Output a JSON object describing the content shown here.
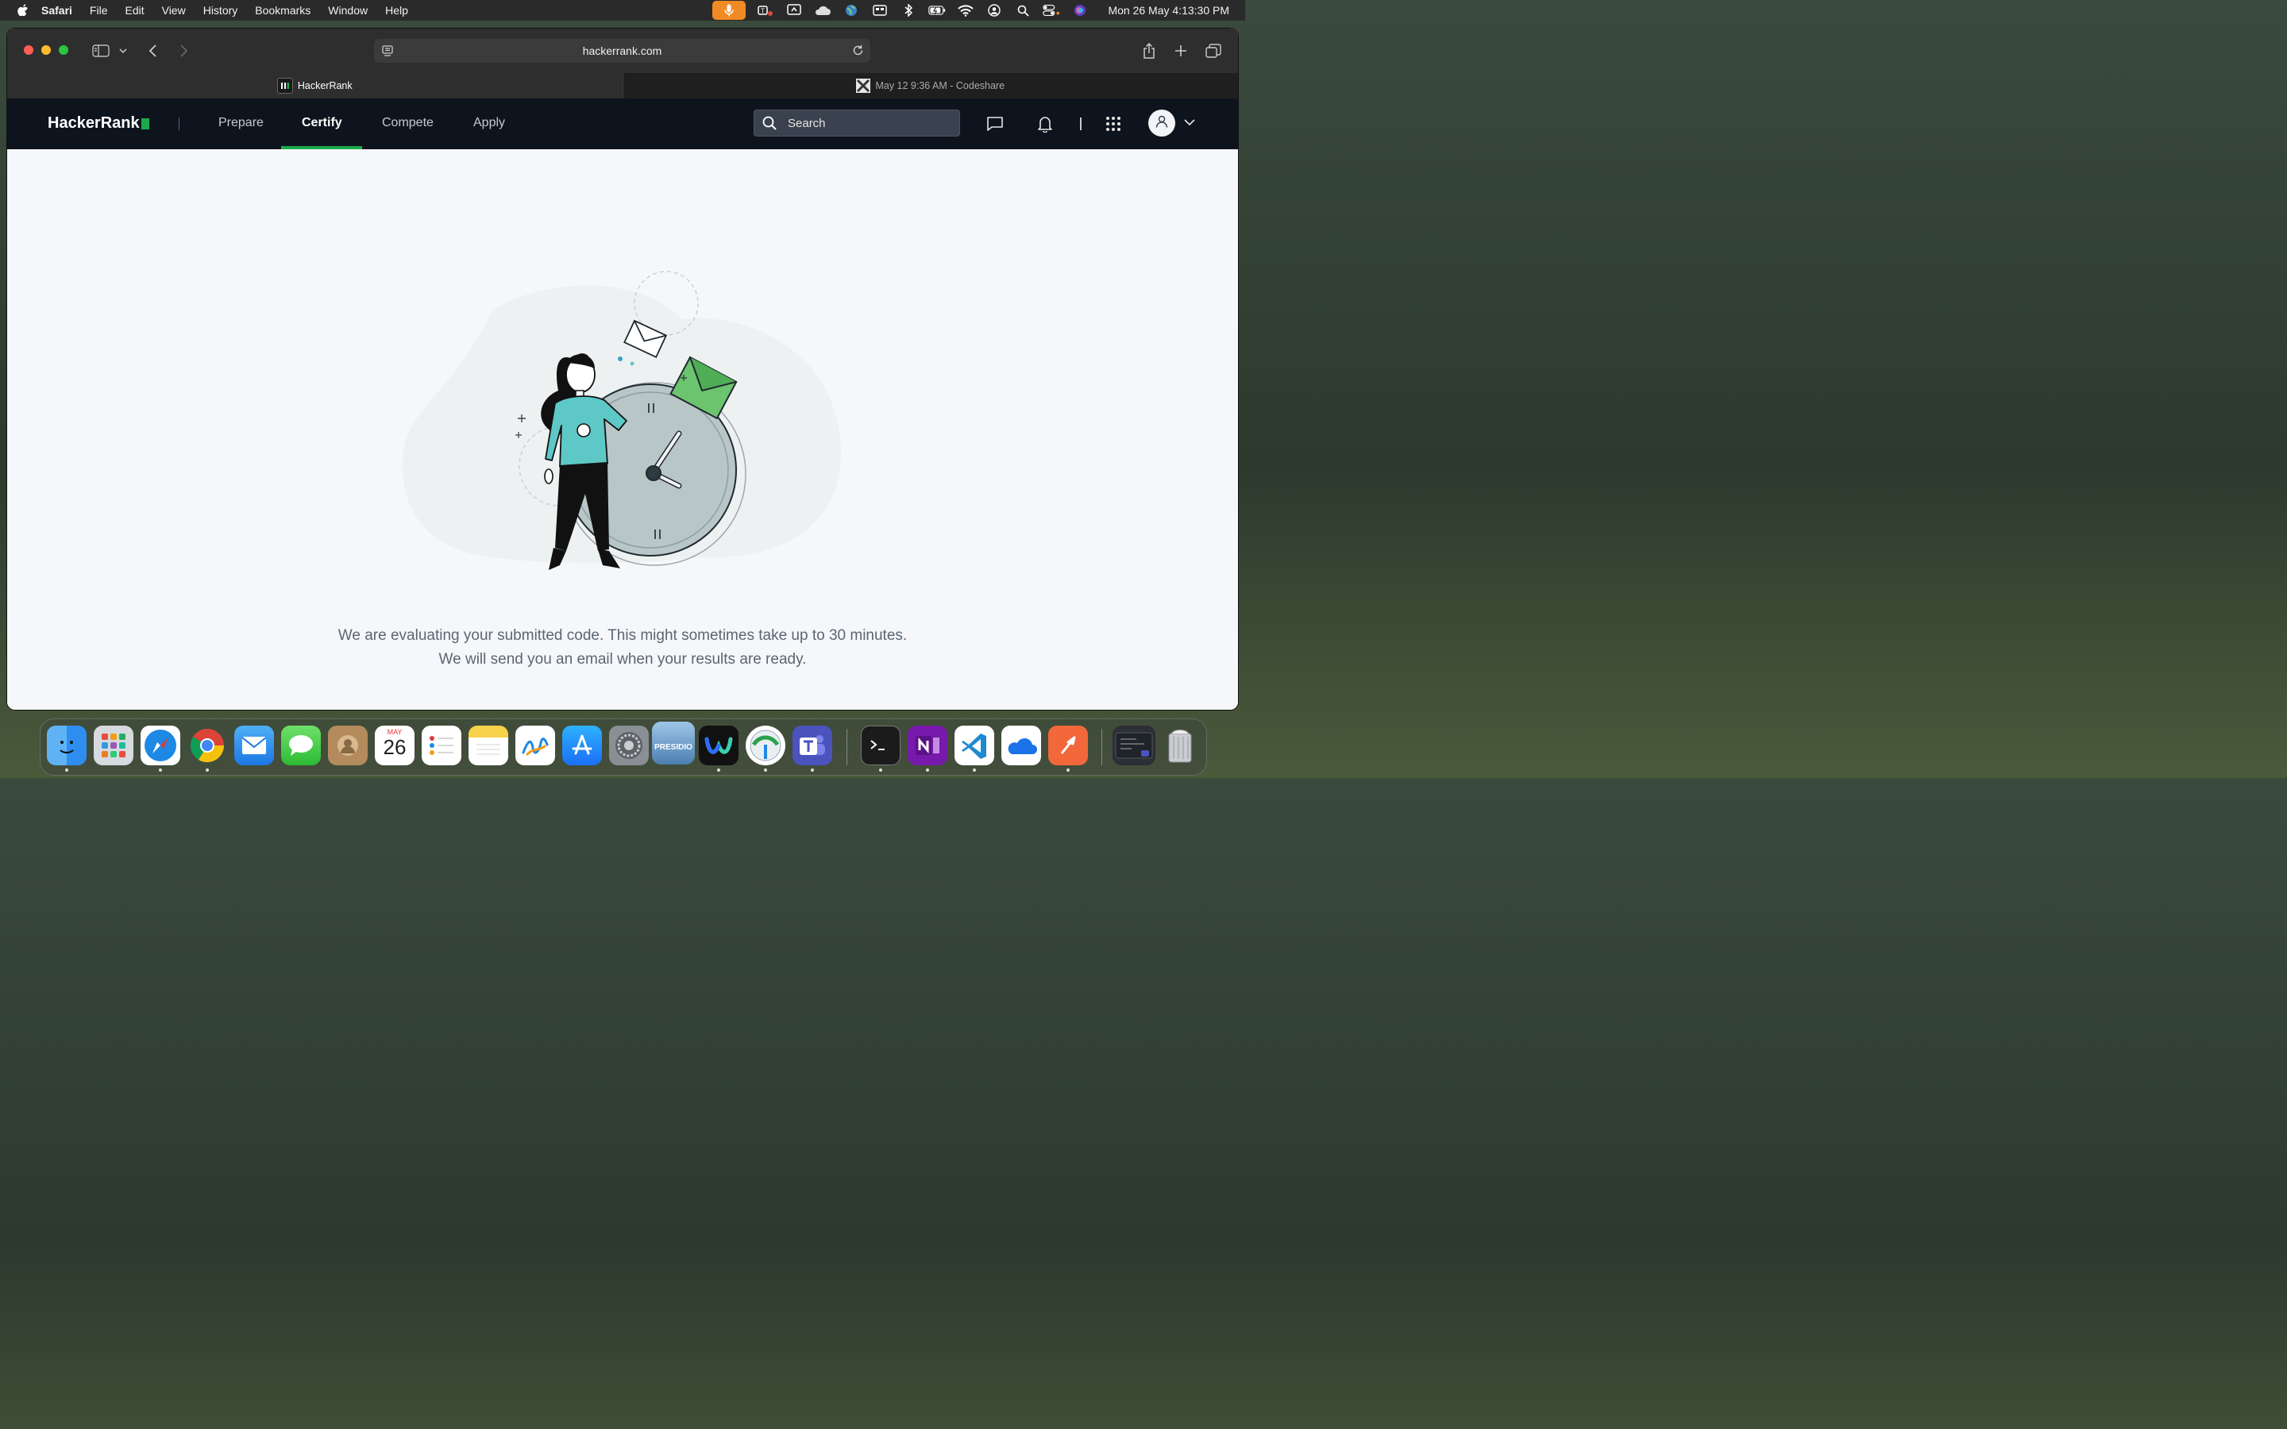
{
  "menubar": {
    "app_name": "Safari",
    "items": [
      "File",
      "Edit",
      "View",
      "History",
      "Bookmarks",
      "Window",
      "Help"
    ],
    "clock": "Mon 26 May  4:13:30 PM"
  },
  "browser": {
    "url": "hackerrank.com",
    "tabs": [
      {
        "label": "HackerRank",
        "active": true
      },
      {
        "label": "May 12 9:36 AM - Codeshare",
        "active": false
      }
    ]
  },
  "hackerrank": {
    "logo": "HackerRank",
    "nav": {
      "prepare": "Prepare",
      "certify": "Certify",
      "compete": "Compete",
      "apply": "Apply",
      "active": "Certify"
    },
    "search_placeholder": "Search"
  },
  "message": {
    "line1": "We are evaluating your submitted code. This might sometimes take up to 30 minutes.",
    "line2": "We will send you an email when your results are ready."
  },
  "dock": {
    "calendar_month": "MAY",
    "calendar_day": "26",
    "presidio_label": "PRESIDIO"
  },
  "colors": {
    "brand_green": "#1ba94c",
    "nav_bg": "#0e141e",
    "illustration_teal": "#5ec8c6",
    "illustration_green": "#6cc46e"
  }
}
